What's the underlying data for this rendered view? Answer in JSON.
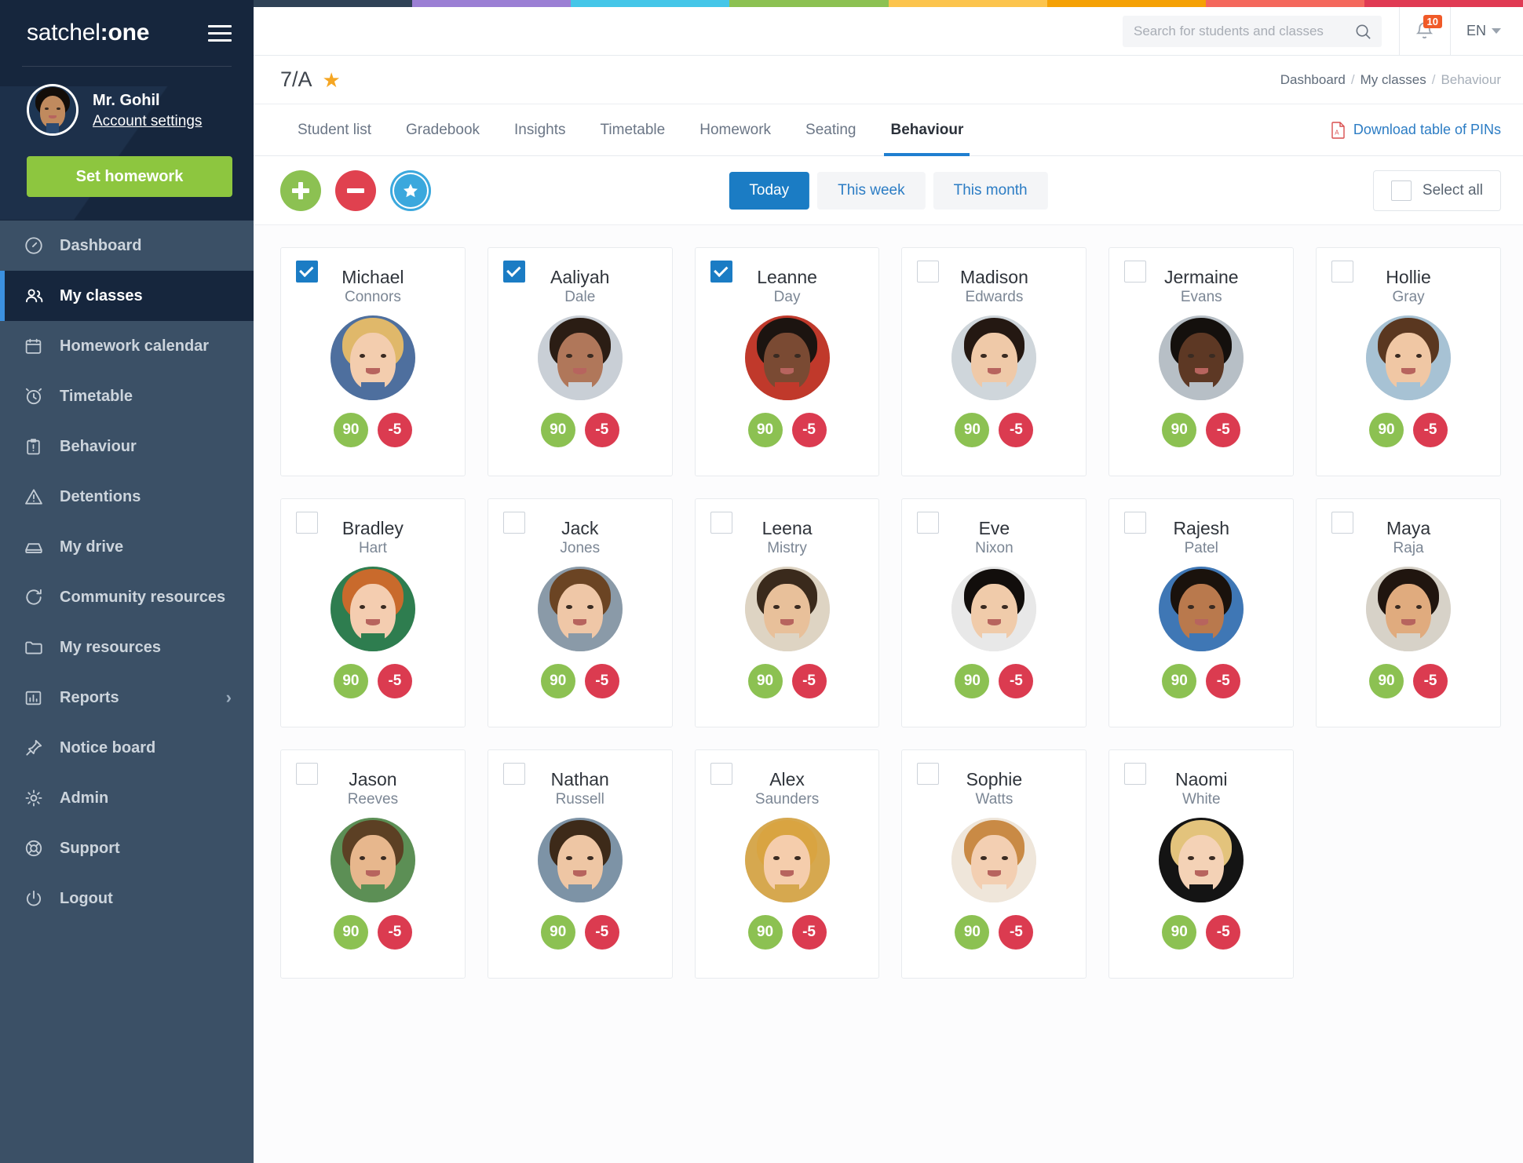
{
  "brand": {
    "light": "satchel",
    "bold": ":one"
  },
  "user": {
    "name": "Mr. Gohil",
    "account_link": "Account settings",
    "cta": "Set homework"
  },
  "sidebar": {
    "items": [
      {
        "label": "Dashboard",
        "icon": "gauge-icon",
        "active": false
      },
      {
        "label": "My classes",
        "icon": "people-icon",
        "active": true
      },
      {
        "label": "Homework calendar",
        "icon": "calendar-icon",
        "active": false
      },
      {
        "label": "Timetable",
        "icon": "clock-icon",
        "active": false
      },
      {
        "label": "Behaviour",
        "icon": "clipboard-icon",
        "active": false
      },
      {
        "label": "Detentions",
        "icon": "warning-icon",
        "active": false
      },
      {
        "label": "My drive",
        "icon": "drive-icon",
        "active": false
      },
      {
        "label": "Community resources",
        "icon": "refresh-icon",
        "active": false
      },
      {
        "label": "My resources",
        "icon": "folder-icon",
        "active": false
      },
      {
        "label": "Reports",
        "icon": "bar-chart-icon",
        "active": false,
        "chevron": "›"
      },
      {
        "label": "Notice board",
        "icon": "pin-icon",
        "active": false
      },
      {
        "label": "Admin",
        "icon": "gear-icon",
        "active": false
      },
      {
        "label": "Support",
        "icon": "lifebuoy-icon",
        "active": false
      },
      {
        "label": "Logout",
        "icon": "power-icon",
        "active": false
      }
    ]
  },
  "topbar": {
    "search_placeholder": "Search for students and classes",
    "search_value": "",
    "notification_count": "10",
    "language": "EN"
  },
  "page": {
    "class_name": "7/A",
    "favourite_star": "★",
    "breadcrumb": [
      {
        "label": "Dashboard",
        "current": false
      },
      {
        "label": "My classes",
        "current": false
      },
      {
        "label": "Behaviour",
        "current": true
      }
    ],
    "breadcrumb_separator": "/"
  },
  "tabs": [
    {
      "label": "Student list",
      "active": false
    },
    {
      "label": "Gradebook",
      "active": false
    },
    {
      "label": "Insights",
      "active": false
    },
    {
      "label": "Timetable",
      "active": false
    },
    {
      "label": "Homework",
      "active": false
    },
    {
      "label": "Seating",
      "active": false
    },
    {
      "label": "Behaviour",
      "active": true
    }
  ],
  "download_link": "Download table of PINs",
  "toolbar": {
    "positive_button": "+",
    "negative_button": "–",
    "star_button": "★",
    "periods": [
      {
        "label": "Today",
        "active": true
      },
      {
        "label": "This week",
        "active": false
      },
      {
        "label": "This month",
        "active": false
      }
    ],
    "select_all": "Select all",
    "select_all_checked": false
  },
  "students": [
    {
      "first": "Michael",
      "last": "Connors",
      "positive": "90",
      "negative": "-5",
      "checked": true,
      "photo": {
        "hair": "#e0b86a",
        "face": "#f3cdae",
        "bg": "#4e6f9e"
      }
    },
    {
      "first": "Aaliyah",
      "last": "Dale",
      "positive": "90",
      "negative": "-5",
      "checked": true,
      "photo": {
        "hair": "#2b1d14",
        "face": "#b0775a",
        "bg": "#c9cfd6"
      }
    },
    {
      "first": "Leanne",
      "last": "Day",
      "positive": "90",
      "negative": "-5",
      "checked": true,
      "photo": {
        "hair": "#1c1410",
        "face": "#7a4a33",
        "bg": "#c0392b"
      }
    },
    {
      "first": "Madison",
      "last": "Edwards",
      "positive": "90",
      "negative": "-5",
      "checked": false,
      "photo": {
        "hair": "#241812",
        "face": "#efc9a8",
        "bg": "#cfd6db"
      }
    },
    {
      "first": "Jermaine",
      "last": "Evans",
      "positive": "90",
      "negative": "-5",
      "checked": false,
      "photo": {
        "hair": "#14100d",
        "face": "#5d3824",
        "bg": "#b7bfc6"
      }
    },
    {
      "first": "Hollie",
      "last": "Gray",
      "positive": "90",
      "negative": "-5",
      "checked": false,
      "photo": {
        "hair": "#5a3720",
        "face": "#f0c7a4",
        "bg": "#a7c2d4"
      }
    },
    {
      "first": "Bradley",
      "last": "Hart",
      "positive": "90",
      "negative": "-5",
      "checked": false,
      "photo": {
        "hair": "#c96a2c",
        "face": "#f4cdb0",
        "bg": "#2e7d4f"
      }
    },
    {
      "first": "Jack",
      "last": "Jones",
      "positive": "90",
      "negative": "-5",
      "checked": false,
      "photo": {
        "hair": "#6b4423",
        "face": "#efc7a7",
        "bg": "#8a9aa8"
      }
    },
    {
      "first": "Leena",
      "last": "Mistry",
      "positive": "90",
      "negative": "-5",
      "checked": false,
      "photo": {
        "hair": "#3a2a1c",
        "face": "#e8c09a",
        "bg": "#ded4c3"
      }
    },
    {
      "first": "Eve",
      "last": "Nixon",
      "positive": "90",
      "negative": "-5",
      "checked": false,
      "photo": {
        "hair": "#120e0c",
        "face": "#f0cbaa",
        "bg": "#e8e8e8"
      }
    },
    {
      "first": "Rajesh",
      "last": "Patel",
      "positive": "90",
      "negative": "-5",
      "checked": false,
      "photo": {
        "hair": "#1a120c",
        "face": "#b9794d",
        "bg": "#3f77b5"
      }
    },
    {
      "first": "Maya",
      "last": "Raja",
      "positive": "90",
      "negative": "-5",
      "checked": false,
      "photo": {
        "hair": "#20150f",
        "face": "#e0ab7e",
        "bg": "#d7d2c8"
      }
    },
    {
      "first": "Jason",
      "last": "Reeves",
      "positive": "90",
      "negative": "-5",
      "checked": false,
      "photo": {
        "hair": "#5c4024",
        "face": "#e7b78d",
        "bg": "#5c8f55"
      }
    },
    {
      "first": "Nathan",
      "last": "Russell",
      "positive": "90",
      "negative": "-5",
      "checked": false,
      "photo": {
        "hair": "#3d2a19",
        "face": "#eec6a4",
        "bg": "#7d93a6"
      }
    },
    {
      "first": "Alex",
      "last": "Saunders",
      "positive": "90",
      "negative": "-5",
      "checked": false,
      "photo": {
        "hair": "#d9a441",
        "face": "#f5cdac",
        "bg": "#d6a84f"
      }
    },
    {
      "first": "Sophie",
      "last": "Watts",
      "positive": "90",
      "negative": "-5",
      "checked": false,
      "photo": {
        "hair": "#c98a45",
        "face": "#f3cfb2",
        "bg": "#efe6da"
      }
    },
    {
      "first": "Naomi",
      "last": "White",
      "positive": "90",
      "negative": "-5",
      "checked": false,
      "photo": {
        "hair": "#e3c37c",
        "face": "#f4d2b6",
        "bg": "#141414"
      }
    }
  ],
  "colors": {
    "accent_blue": "#1b7cc4",
    "positive_green": "#8cc152",
    "negative_red": "#db3b50",
    "sidebar": "#3b5066",
    "sidebar_dark": "#16263d",
    "cta_green": "#8dc63f",
    "star_gold": "#f5a623",
    "rainbow": [
      "#2f4256",
      "#9b7fd4",
      "#45c6e8",
      "#8cc152",
      "#fcc44d",
      "#f5a105",
      "#f4685c",
      "#e03a53"
    ]
  }
}
